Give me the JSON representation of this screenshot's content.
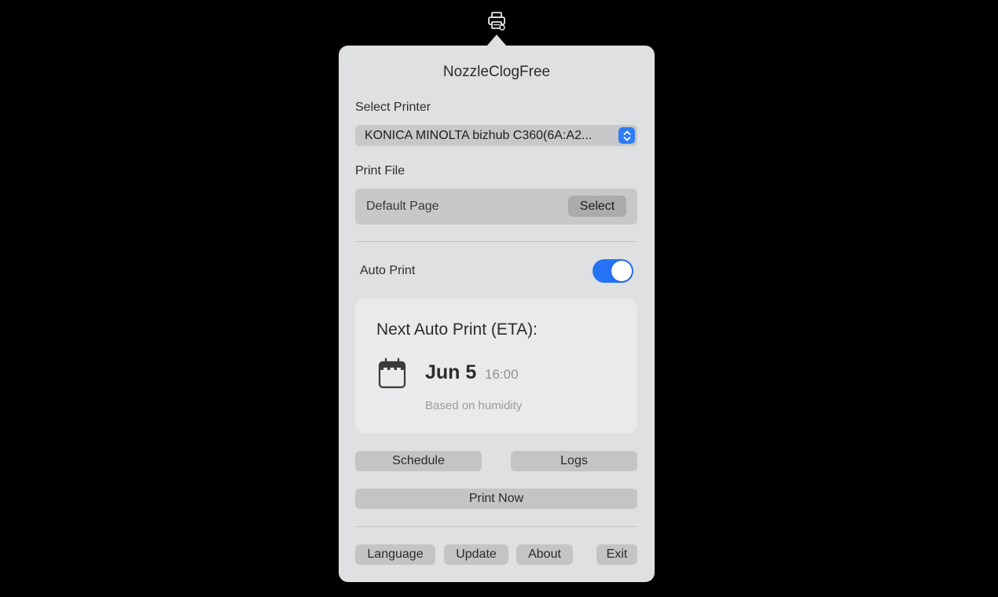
{
  "menubar": {
    "icon": "printer-icon"
  },
  "popover": {
    "title": "NozzleClogFree",
    "printer": {
      "label": "Select Printer",
      "value": "KONICA MINOLTA bizhub C360(6A:A2..."
    },
    "print_file": {
      "label": "Print File",
      "value": "Default Page",
      "select_label": "Select"
    },
    "auto_print": {
      "label": "Auto Print",
      "enabled": true
    },
    "eta": {
      "title": "Next Auto Print (ETA):",
      "date": "Jun 5",
      "time": "16:00",
      "note": "Based on humidity",
      "icon": "calendar-icon"
    },
    "buttons": {
      "schedule": "Schedule",
      "logs": "Logs",
      "print_now": "Print Now"
    },
    "footer": {
      "language": "Language",
      "update": "Update",
      "about": "About",
      "exit": "Exit"
    }
  },
  "colors": {
    "accent": "#2672f5",
    "panel": "#dfe0e1",
    "card": "#e9eaeb",
    "control": "#c6c8ca"
  }
}
